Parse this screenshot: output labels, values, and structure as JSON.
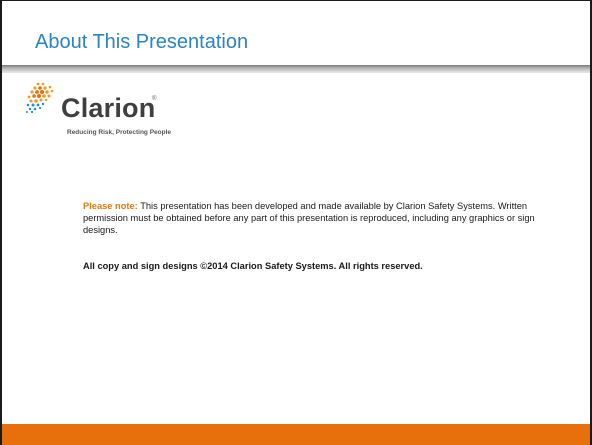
{
  "slide": {
    "title": "About This Presentation",
    "accent_color": "#2b84c4",
    "footer_color": "#e8700c"
  },
  "logo": {
    "wordmark": "Clarion",
    "registered": "®",
    "tagline": "Reducing Risk, Protecting People",
    "dot_colors": [
      "#f29a1f",
      "#e8700c",
      "#1e8fd0"
    ]
  },
  "note": {
    "label": "Please note:",
    "text": " This presentation has been developed and made available by Clarion Safety Systems. Written permission must be obtained before any part of this presentation is reproduced, including any graphics or sign designs."
  },
  "copyright": {
    "text": "All copy and sign designs ©2014 Clarion Safety Systems. All rights reserved."
  }
}
